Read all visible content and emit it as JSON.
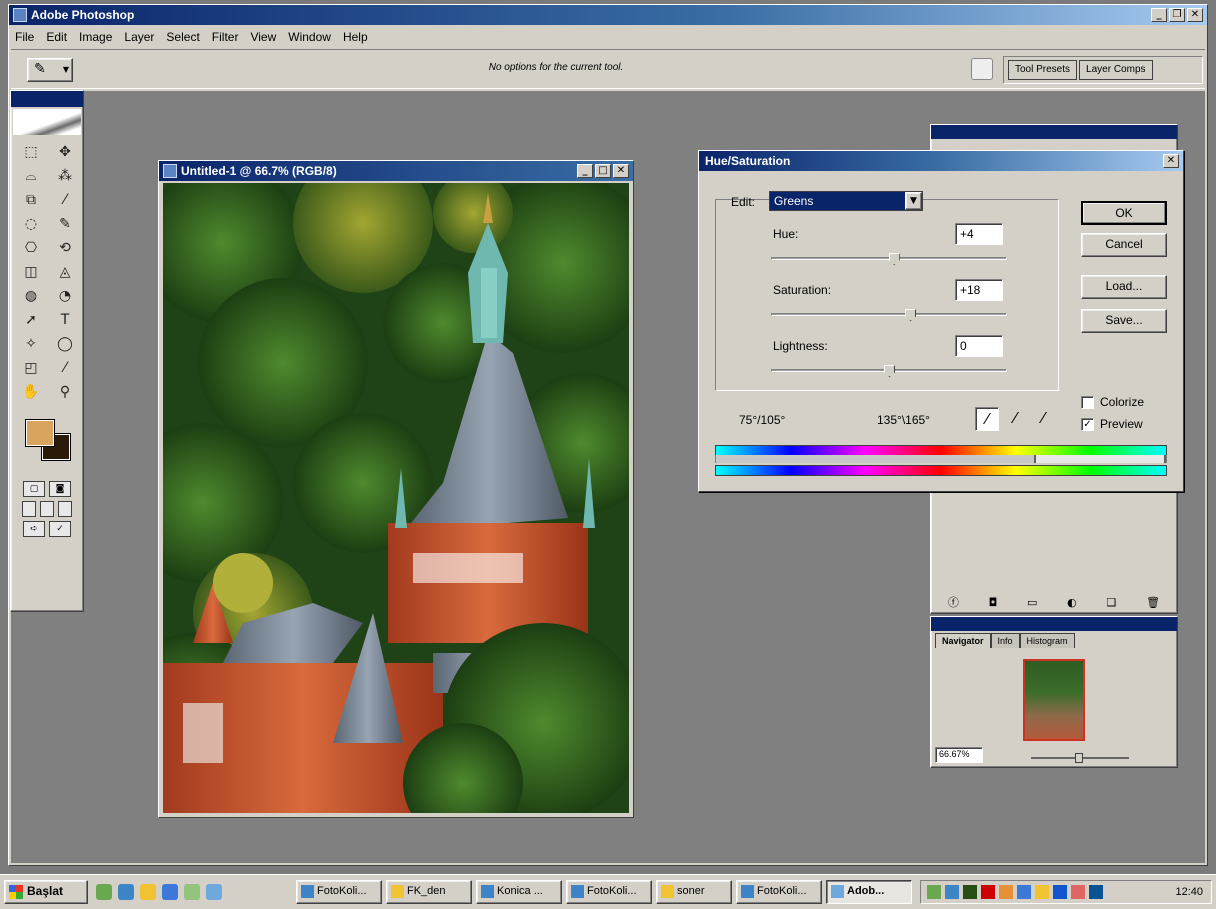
{
  "app": {
    "title": "Adobe Photoshop",
    "menu": [
      "File",
      "Edit",
      "Image",
      "Layer",
      "Select",
      "Filter",
      "View",
      "Window",
      "Help"
    ],
    "options_text": "No options for the current tool.",
    "well_tabs": [
      "Tool Presets",
      "Layer Comps"
    ]
  },
  "toolbox": {
    "tools": [
      "⬚",
      "✥",
      "⌓",
      "⁂",
      "⧉",
      "⁄",
      "◌",
      "✎",
      "⎔",
      "⟲",
      "◫",
      "◬",
      "◍",
      "◔",
      "➚",
      "T",
      "✧",
      "◯",
      "◰",
      "⁄",
      "✋",
      "⚲"
    ],
    "foreground_color": "#d9a45e",
    "background_color": "#2a1a08"
  },
  "document": {
    "title": "Untitled-1 @ 66.7% (RGB/8)"
  },
  "hue_saturation": {
    "title": "Hue/Saturation",
    "edit_label": "Edit:",
    "edit_value": "Greens",
    "sliders": [
      {
        "label": "Hue:",
        "value": "+4",
        "position": 0.52
      },
      {
        "label": "Saturation:",
        "value": "+18",
        "position": 0.59
      },
      {
        "label": "Lightness:",
        "value": "0",
        "position": 0.5
      }
    ],
    "buttons": {
      "ok": "OK",
      "cancel": "Cancel",
      "load": "Load...",
      "save": "Save..."
    },
    "range_left": "75°/105°",
    "range_right": "135°\\165°",
    "colorize_label": "Colorize",
    "colorize_checked": false,
    "preview_label": "Preview",
    "preview_checked": true
  },
  "navigator": {
    "tabs": [
      "Navigator",
      "Info",
      "Histogram"
    ],
    "zoom": "66.67%"
  },
  "taskbar": {
    "start_label": "Başlat",
    "tasks": [
      "FotoKoli...",
      "FK_den",
      "Konica ...",
      "FotoKoli...",
      "soner",
      "FotoKoli...",
      "Adob..."
    ],
    "clock": "12:40"
  }
}
